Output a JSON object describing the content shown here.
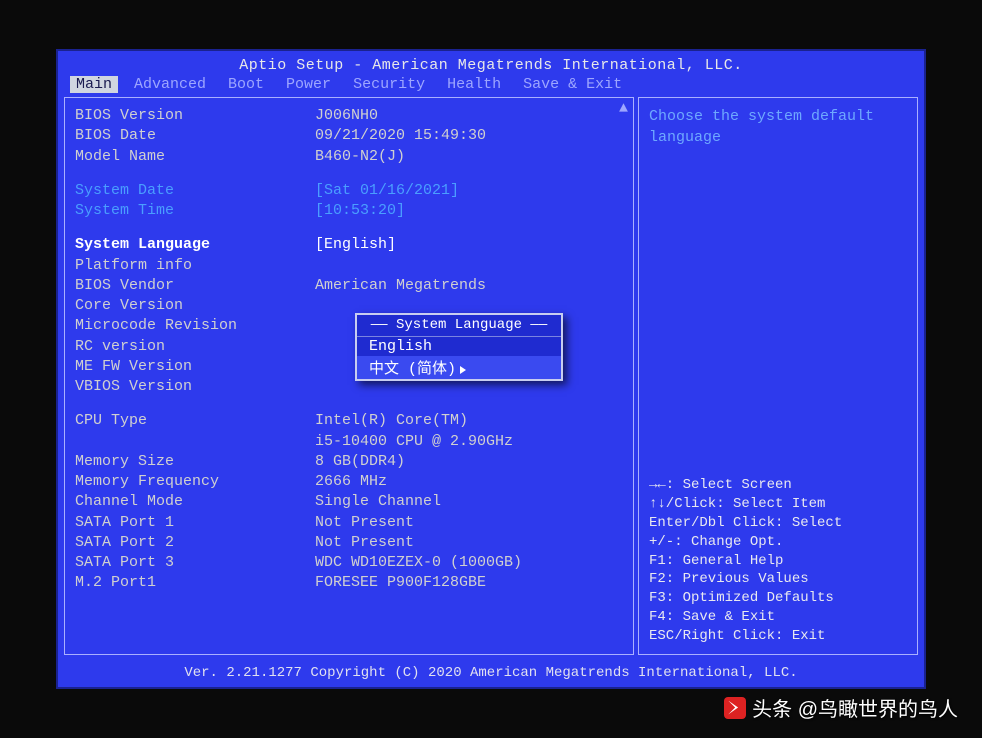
{
  "title": "Aptio Setup - American Megatrends International, LLC.",
  "footer": "Ver. 2.21.1277 Copyright (C) 2020 American Megatrends International, LLC.",
  "menu": {
    "items": [
      "Main",
      "Advanced",
      "Boot",
      "Power",
      "Security",
      "Health",
      "Save & Exit"
    ],
    "active_index": 0
  },
  "main": {
    "rows": [
      {
        "label": "BIOS Version",
        "value": "J006NH0",
        "type": "static"
      },
      {
        "label": "BIOS Date",
        "value": "09/21/2020 15:49:30",
        "type": "static"
      },
      {
        "label": "Model Name",
        "value": "B460-N2(J)",
        "type": "static"
      },
      {
        "type": "spacer"
      },
      {
        "label": "System Date",
        "value": "[Sat 01/16/2021]",
        "type": "interactive"
      },
      {
        "label": "System Time",
        "value": "[10:53:20]",
        "type": "interactive"
      },
      {
        "type": "spacer"
      },
      {
        "label": "System Language",
        "value": "[English]",
        "type": "selected"
      },
      {
        "label": "Platform info",
        "value": "",
        "type": "static"
      },
      {
        "label": "BIOS Vendor",
        "value": "American Megatrends",
        "type": "static"
      },
      {
        "label": "Core Version",
        "value": "",
        "type": "static"
      },
      {
        "label": "Microcode Revision",
        "value": "",
        "type": "static"
      },
      {
        "label": "RC version",
        "value": "",
        "type": "static"
      },
      {
        "label": "ME FW Version",
        "value": "",
        "type": "static"
      },
      {
        "label": "VBIOS Version",
        "value": "",
        "type": "static"
      },
      {
        "type": "spacer"
      },
      {
        "label": "CPU Type",
        "value": "Intel(R) Core(TM)",
        "type": "static"
      },
      {
        "label": "",
        "value": "i5-10400 CPU @ 2.90GHz",
        "type": "static"
      },
      {
        "label": "Memory Size",
        "value": "8 GB(DDR4)",
        "type": "static"
      },
      {
        "label": "Memory Frequency",
        "value": "2666 MHz",
        "type": "static"
      },
      {
        "label": "Channel Mode",
        "value": "Single Channel",
        "type": "static"
      },
      {
        "label": "SATA Port 1",
        "value": "Not Present",
        "type": "static"
      },
      {
        "label": "SATA Port 2",
        "value": "Not Present",
        "type": "static"
      },
      {
        "label": "SATA Port 3",
        "value": "WDC WD10EZEX-0 (1000GB)",
        "type": "static"
      },
      {
        "label": "M.2 Port1",
        "value": "FORESEE P900F128GBE",
        "type": "static"
      }
    ]
  },
  "popup": {
    "title": "System Language",
    "items": [
      "English",
      "中文 (简体)"
    ],
    "hover_index": 1
  },
  "help": {
    "top": "Choose the system default language",
    "hints": [
      "→←: Select Screen",
      "↑↓/Click: Select Item",
      "Enter/Dbl Click: Select",
      "+/-: Change Opt.",
      "F1: General Help",
      "F2: Previous Values",
      "F3: Optimized Defaults",
      "F4: Save & Exit",
      "ESC/Right Click: Exit"
    ]
  },
  "watermark": "@鸟瞰世界的鸟人"
}
